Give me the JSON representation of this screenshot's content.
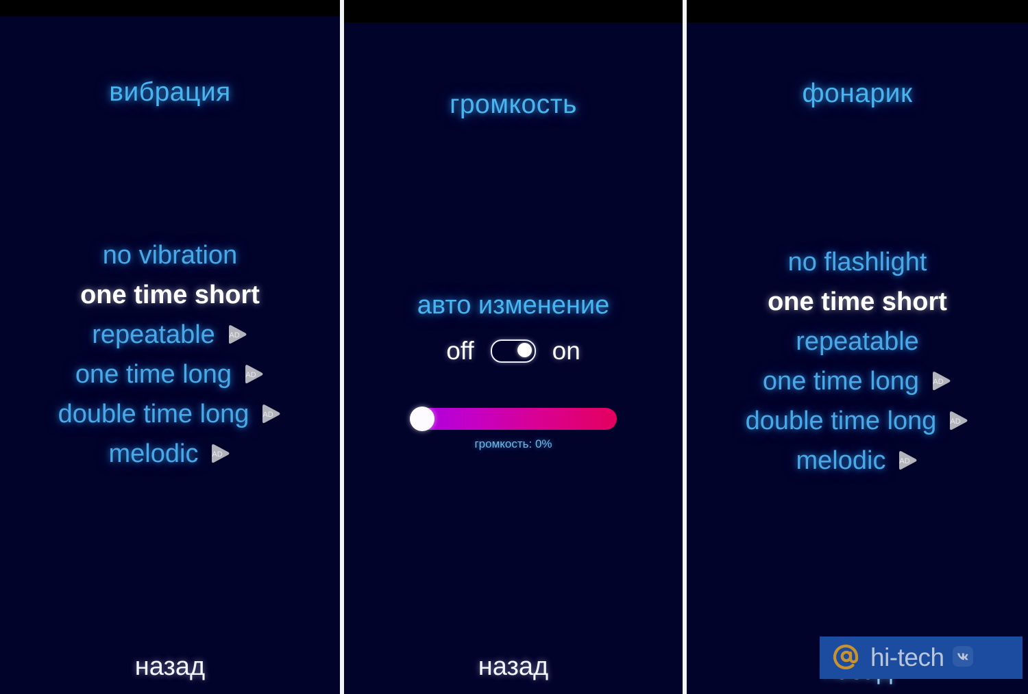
{
  "theme": {
    "background": "#02032b",
    "status_bar": "#000000",
    "divider": "#f2f3f7",
    "accent_blue": "#49a9e8",
    "title_blue": "#49b4ef",
    "selected_white": "#ffffff",
    "slider_gradient_start": "#a800e6",
    "slider_gradient_end": "#e4005e",
    "watermark_bg": "#1b4ca0",
    "watermark_logo": "#c8922e"
  },
  "panels": [
    {
      "id": "vibration",
      "title": "вибрация",
      "back_label": "назад",
      "options": [
        {
          "label": "no vibration",
          "selected": false,
          "ad": false
        },
        {
          "label": "one time short",
          "selected": true,
          "ad": false
        },
        {
          "label": "repeatable",
          "selected": false,
          "ad": true
        },
        {
          "label": "one time long",
          "selected": false,
          "ad": true
        },
        {
          "label": "double time long",
          "selected": false,
          "ad": true
        },
        {
          "label": "melodic",
          "selected": false,
          "ad": true
        }
      ]
    },
    {
      "id": "volume",
      "title": "громкость",
      "back_label": "назад",
      "auto_change_label": "авто изменение",
      "toggle": {
        "off_label": "off",
        "on_label": "on",
        "state": "on",
        "icon": "toggle-on-icon"
      },
      "slider": {
        "value": 0,
        "caption": "громкость: 0%"
      }
    },
    {
      "id": "flashlight",
      "title": "фонарик",
      "back_label": "назад",
      "options": [
        {
          "label": "no flashlight",
          "selected": false,
          "ad": false
        },
        {
          "label": "one time short",
          "selected": true,
          "ad": false
        },
        {
          "label": "repeatable",
          "selected": false,
          "ad": false
        },
        {
          "label": "one time long",
          "selected": false,
          "ad": true
        },
        {
          "label": "double time long",
          "selected": false,
          "ad": true
        },
        {
          "label": "melodic",
          "selected": false,
          "ad": true
        }
      ]
    }
  ],
  "ad_badge": {
    "label": "AD",
    "icon": "ad-play-badge-icon"
  },
  "watermark": {
    "text": "hi-tech",
    "at_icon": "at-sign-icon",
    "vk_icon": "vk-icon"
  }
}
